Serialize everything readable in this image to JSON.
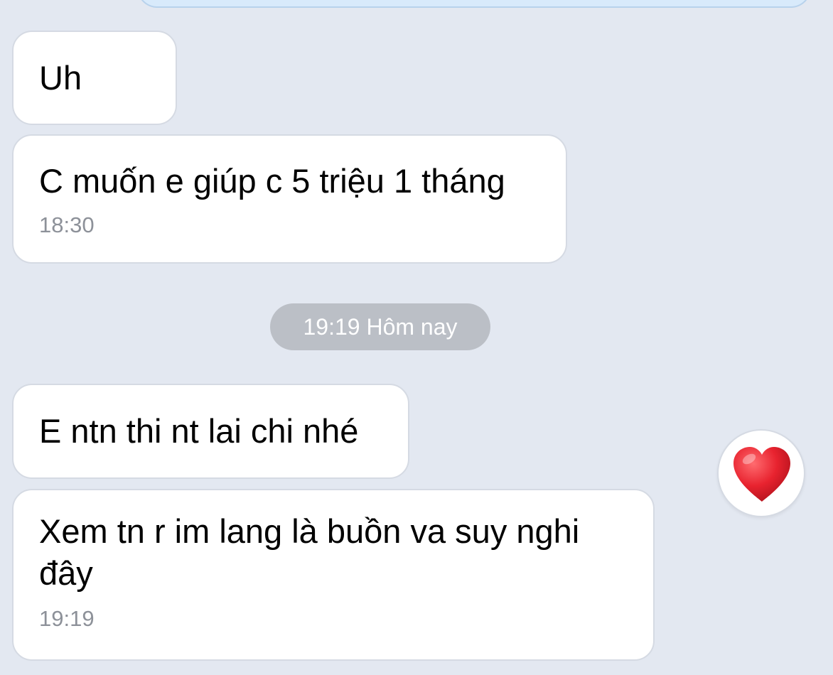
{
  "chat": {
    "messages": [
      {
        "text": "Uh"
      },
      {
        "text": "C muốn e giúp c 5 triệu 1 tháng",
        "time": "18:30"
      },
      {
        "text": "E ntn thi nt lai chi nhé"
      },
      {
        "text": "Xem tn r im lang là buồn va suy nghi đây",
        "time": "19:19",
        "reaction": "heart-icon"
      }
    ],
    "date_divider": "19:19 Hôm nay"
  },
  "colors": {
    "background": "#e3e8f1",
    "received_bubble": "#ffffff",
    "sent_bubble": "#d8eafb",
    "timestamp": "#8d9199",
    "date_pill": "#bbbfc6",
    "heart": "#e8232f"
  }
}
